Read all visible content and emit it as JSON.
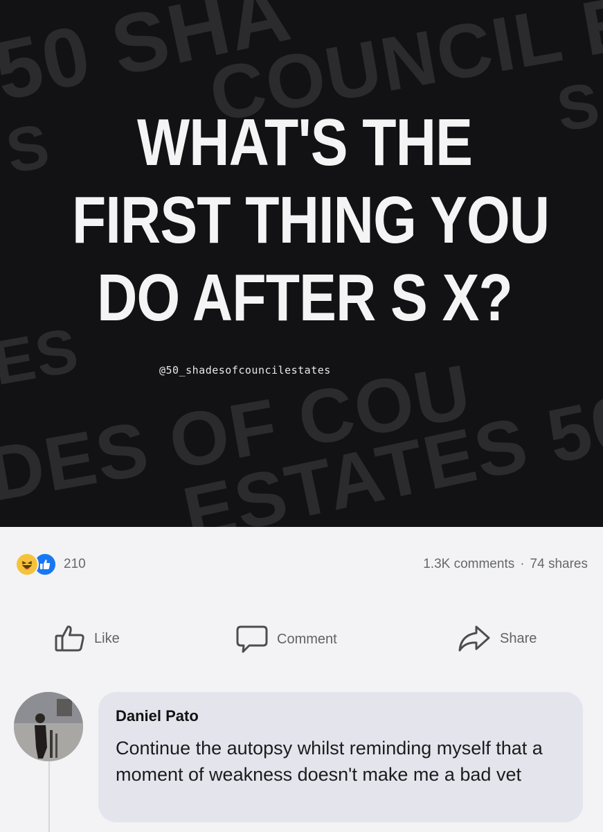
{
  "post": {
    "headline_lines": [
      "WHAT'S THE",
      "FIRST THING YOU",
      "DO AFTER S X?"
    ],
    "watermark": "@50_shadesofcouncilestates",
    "background_words": [
      "50 SHA",
      "COUNCIL E",
      "S",
      "OF",
      "ES",
      "DES OF COU",
      "ESTATES 50"
    ],
    "colors": {
      "image_bg": "#121113",
      "headline": "#f4f4f4"
    }
  },
  "stats": {
    "reaction_icons": [
      "haha-icon",
      "like-icon"
    ],
    "reaction_count": "210",
    "comments": "1.3K comments",
    "separator": "·",
    "shares": "74 shares"
  },
  "actions": {
    "like_label": "Like",
    "comment_label": "Comment",
    "share_label": "Share"
  },
  "comment": {
    "author": "Daniel Pato",
    "text": "Continue the autopsy whilst reminding myself that a moment of weakness doesn't make me a bad vet"
  },
  "theme": {
    "accent": "#1877f2",
    "haha": "#f5c33b",
    "muted_text": "#65676b",
    "bubble": "#e4e4ec"
  }
}
